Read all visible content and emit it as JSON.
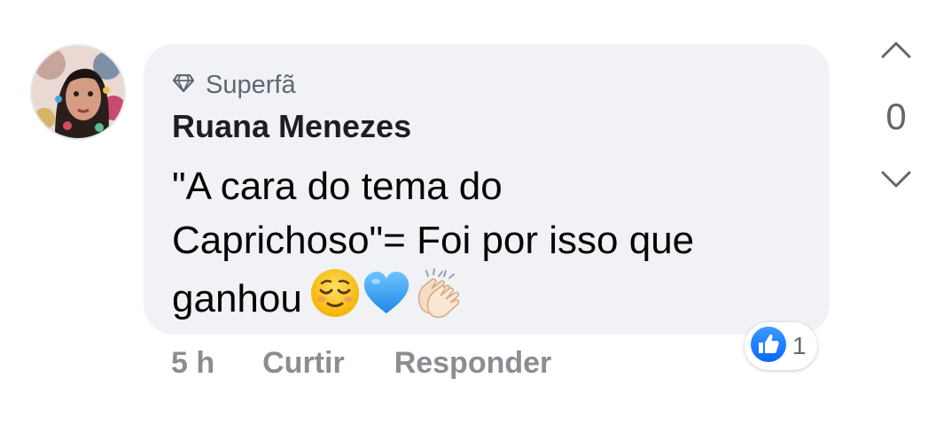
{
  "comment": {
    "badge": {
      "icon": "diamond-icon",
      "label": "Superfã"
    },
    "author": "Ruana Menezes",
    "text_lines": [
      "\"A cara do tema do",
      "Caprichoso\"= Foi por isso que",
      "ganhou"
    ],
    "emojis": [
      "relieved-face-emoji",
      "blue-heart-emoji",
      "clapping-hands-emoji"
    ],
    "timestamp": "5 h",
    "like_label": "Curtir",
    "reply_label": "Responder",
    "reaction": {
      "icon": "thumbs-up-icon",
      "count": "1",
      "color": "#1877f2"
    }
  },
  "vote": {
    "up_icon": "chevron-up-icon",
    "score": "0",
    "down_icon": "chevron-down-icon"
  },
  "colors": {
    "bubble": "#f0f2f5",
    "text": "#050505",
    "muted": "#65676b",
    "like_blue": "#1877f2"
  }
}
